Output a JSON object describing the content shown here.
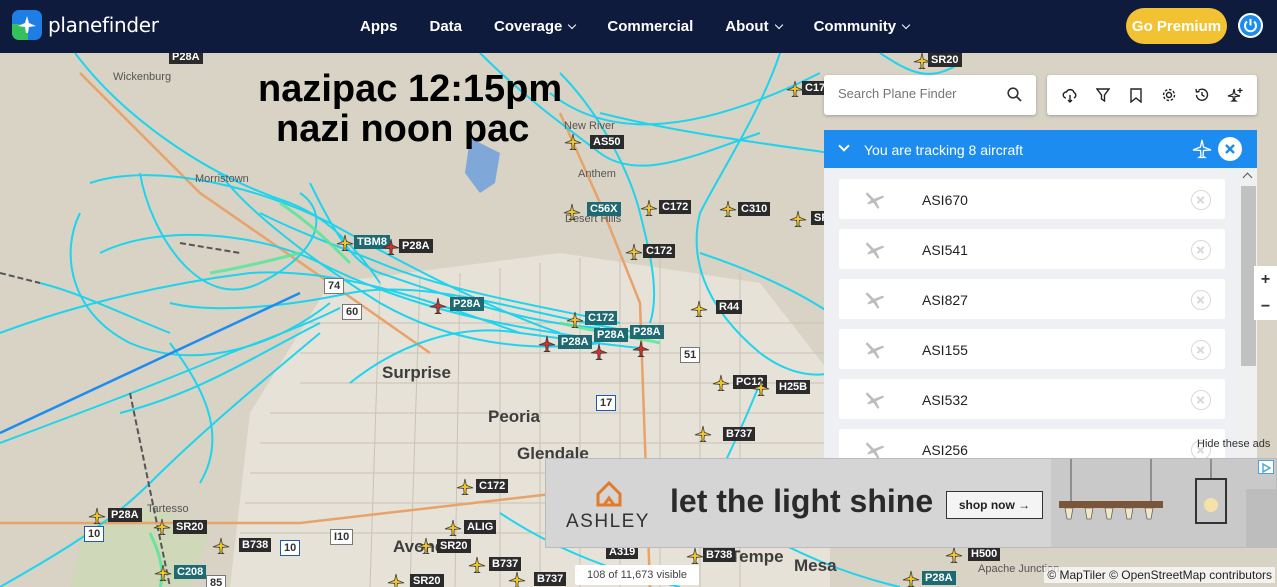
{
  "header": {
    "logo_text": "planefinder",
    "nav": [
      {
        "label": "Apps",
        "dropdown": false
      },
      {
        "label": "Data",
        "dropdown": false
      },
      {
        "label": "Coverage",
        "dropdown": true
      },
      {
        "label": "Commercial",
        "dropdown": false
      },
      {
        "label": "About",
        "dropdown": true
      },
      {
        "label": "Community",
        "dropdown": true
      }
    ],
    "premium_label": "Go Premium",
    "colors": {
      "bar": "#0f1b3d",
      "premium": "#f2c233",
      "accent": "#1c8cf0"
    }
  },
  "map": {
    "overlay_text": [
      "nazipac 12:15pm",
      "nazi noon pac"
    ],
    "places": [
      "Wickenburg",
      "Morristown",
      "New River",
      "Anthem",
      "Desert Hills",
      "Surprise",
      "Peoria",
      "Glendale",
      "Tartesso",
      "Avondale",
      "Tempe",
      "Mesa",
      "Apache Junction"
    ],
    "road_shields": [
      "60",
      "74",
      "51",
      "17",
      "10",
      "10",
      "85"
    ],
    "aircraft_labels": [
      "P28A",
      "SR20",
      "C17",
      "AS50",
      "C56X",
      "C172",
      "C310",
      "SR",
      "TBM8",
      "P28A",
      "C172",
      "P28A",
      "R44",
      "C172",
      "P28A",
      "P28A",
      "P28A",
      "PC12",
      "H25B",
      "B737",
      "C172",
      "P28A",
      "SR20",
      "ALIG",
      "B738",
      "SR20",
      "C208",
      "B737",
      "A319",
      "B738",
      "H500",
      "SR20",
      "B737",
      "P28A",
      "I10"
    ]
  },
  "search": {
    "placeholder": "Search Plane Finder"
  },
  "toolbar": {
    "icons": [
      "weather-icon",
      "filter-icon",
      "bookmark-icon",
      "settings-icon",
      "history-icon",
      "plane-add-icon"
    ]
  },
  "tracking": {
    "header": "You are tracking 8 aircraft",
    "items": [
      "ASI670",
      "ASI541",
      "ASI827",
      "ASI155",
      "ASI532",
      "ASI256"
    ]
  },
  "ads": {
    "hide_label": "Hide these ads",
    "brand": "ASHLEY",
    "headline": "let the light shine",
    "cta": "shop now →"
  },
  "footer": {
    "visible_count": "108 of 11,673 visible",
    "attribution": "© MapTiler © OpenStreetMap contributors"
  }
}
